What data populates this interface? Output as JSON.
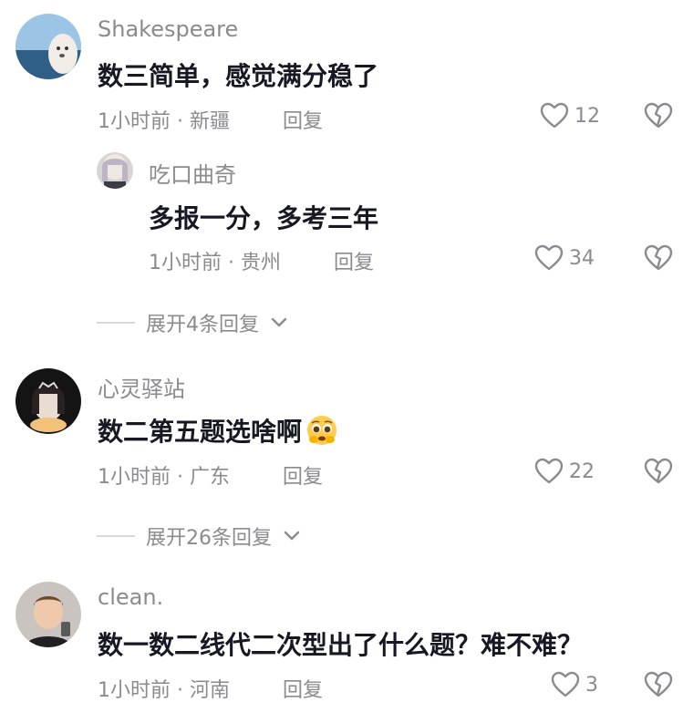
{
  "comments": [
    {
      "username": "Shakespeare",
      "content": "数三简单，感觉满分稳了",
      "meta": "1小时前 · 新疆",
      "reply_label": "回复",
      "likes": "12",
      "avatar_colors": {
        "sky": "#9cc4e4",
        "sea": "#2f5f86",
        "fur": "#f2eee7"
      },
      "replies": [
        {
          "username": "吃口曲奇",
          "content": "多报一分，多考三年",
          "meta": "1小时前 · 贵州",
          "reply_label": "回复",
          "likes": "34"
        }
      ],
      "expand_label": "展开4条回复"
    },
    {
      "username": "心灵驿站",
      "content": "数二第五题选啥啊",
      "meta": "1小时前 · 广东",
      "reply_label": "回复",
      "likes": "22",
      "emoji": "pleading-face-emoji",
      "expand_label": "展开26条回复"
    },
    {
      "username": "clean.",
      "content": "数一数二线代二次型出了什么题？难不难？",
      "meta": "1小时前 · 河南",
      "reply_label": "回复",
      "likes": "3"
    }
  ],
  "icons": {
    "like": "heart-outline-icon",
    "dislike": "broken-heart-icon",
    "expand": "chevron-down-icon"
  }
}
